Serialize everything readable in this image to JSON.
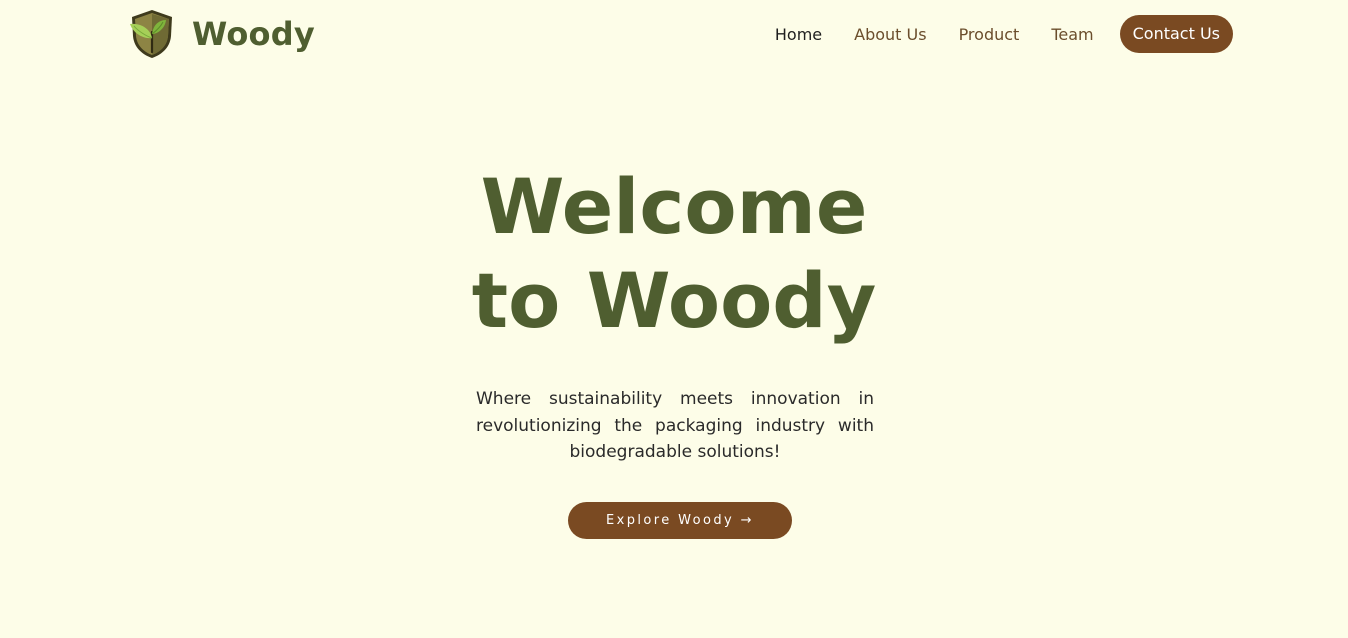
{
  "brand": {
    "name": "Woody",
    "logo_icon": "leaf-shield-icon"
  },
  "nav": {
    "links": [
      {
        "label": "Home",
        "active": true
      },
      {
        "label": "About Us",
        "active": false
      },
      {
        "label": "Product",
        "active": false
      },
      {
        "label": "Team",
        "active": false
      }
    ],
    "cta_label": "Contact Us"
  },
  "hero": {
    "title_line1": "Welcome",
    "title_line2": "to Woody",
    "subtitle": "Where sustainability meets innovation in revolutionizing the packaging industry with biodegradable solutions!",
    "button_label": "Explore Woody →"
  },
  "colors": {
    "background": "#fdfde8",
    "primary_green": "#4f5e30",
    "accent_brown": "#7a4a22",
    "nav_text": "#6b4e2c"
  }
}
